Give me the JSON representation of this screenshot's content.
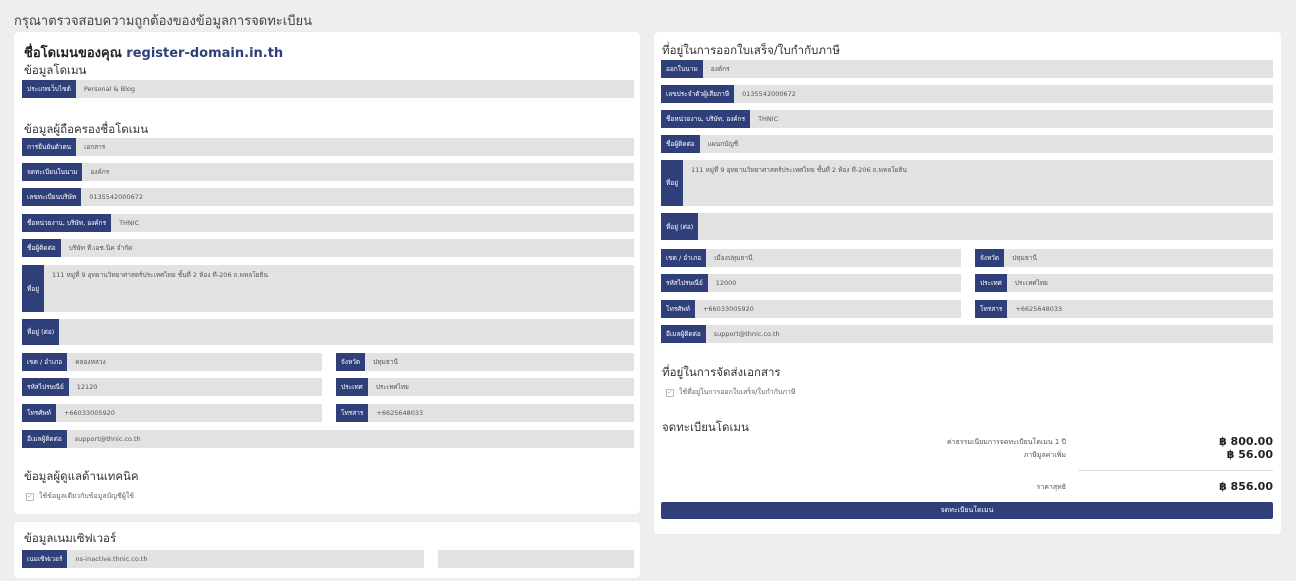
{
  "page_title": "กรุณาตรวจสอบความถูกต้องของข้อมูลการจดทะเบียน",
  "left": {
    "domain_heading_prefix": "ชื่อโดเมนของคุณ",
    "domain_name": "register-domain.in.th",
    "domain_section_title": "ข้อมูลโดเมน",
    "domain_type_label": "ประเภทเว็บไซต์",
    "domain_type_value": "Personal & Blog",
    "holder_section_title": "ข้อมูลผู้ถือครองชื่อโดเมน",
    "holder_fields": [
      {
        "label": "การยืนยันตัวตน",
        "value": "เอกสาร"
      },
      {
        "label": "จดทะเบียนในนาม",
        "value": "องค์กร"
      },
      {
        "label": "เลขทะเบียนบริษัท",
        "value": "0135542000672"
      },
      {
        "label": "ชื่อหน่วยงาน, บริษัท, องค์กร",
        "value": "THNIC"
      },
      {
        "label": "ชื่อผู้ติดต่อ",
        "value": "บริษัท ที.เอช.นิค จำกัด"
      }
    ],
    "address_label": "ที่อยู่",
    "address_value": "111 หมู่ที่ 9 อุทยานวิทยาศาสตร์ประเทศไทย ชั้นที่ 2 ห้อง ที-206 ถ.พหลโยธิน",
    "address2_label": "ที่อยู่ (ต่อ)",
    "address2_value": "",
    "district_label": "เขต / อำเภอ",
    "district_value": "คลองหลวง",
    "province_label": "จังหวัด",
    "province_value": "ปทุมธานี",
    "postcode_label": "รหัสไปรษณีย์",
    "postcode_value": "12120",
    "country_label": "ประเทศ",
    "country_value": "ประเทศไทย",
    "phone_label": "โทรศัพท์",
    "phone_value": "+66033005920",
    "fax_label": "โทรสาร",
    "fax_value": "+6625648033",
    "email_label": "อีเมลผู้ติดต่อ",
    "email_value": "support@thnic.co.th",
    "tech_section_title": "ข้อมูลผู้ดูแลด้านเทคนิค",
    "tech_checkbox_label": "ใช้ข้อมูลเดียวกับข้อมูลบัญชีผู้ใช้",
    "ns_section_title": "ข้อมูลเนมเซิฟเวอร์",
    "ns_label": "เนมเซิฟเวอร์",
    "ns_value": "ns-inactive.thnic.co.th"
  },
  "right": {
    "invoice_section_title": "ที่อยู่ในการออกใบเสร็จ/ใบกำกับภาษี",
    "invoice_fields": [
      {
        "label": "ออกในนาม",
        "value": "องค์กร"
      },
      {
        "label": "เลขประจำตัวผู้เสียภาษี",
        "value": "0135542000672"
      },
      {
        "label": "ชื่อหน่วยงาน, บริษัท, องค์กร",
        "value": "THNIC"
      },
      {
        "label": "ชื่อผู้ติดต่อ",
        "value": "แผนกบัญชี"
      }
    ],
    "address_label": "ที่อยู่",
    "address_value": "111 หมู่ที่ 9 อุทยานวิทยาศาสตร์ประเทศไทย ชั้นที่ 2 ห้อง ที-206 ถ.พหลโยธิน",
    "address2_label": "ที่อยู่ (ต่อ)",
    "address2_value": "",
    "district_label": "เขต / อำเภอ",
    "district_value": "เมืองปทุมธานี",
    "province_label": "จังหวัด",
    "province_value": "ปทุมธานี",
    "postcode_label": "รหัสไปรษณีย์",
    "postcode_value": "12000",
    "country_label": "ประเทศ",
    "country_value": "ประเทศไทย",
    "phone_label": "โทรศัพท์",
    "phone_value": "+66033005920",
    "fax_label": "โทรสาร",
    "fax_value": "+6625648033",
    "email_label": "อีเมลผู้ติดต่อ",
    "email_value": "support@thnic.co.th",
    "shipping_section_title": "ที่อยู่ในการจัดส่งเอกสาร",
    "shipping_checkbox_label": "ใช้ที่อยู่ในการออกใบเสร็จ/ใบกำกับภาษี",
    "register_section_title": "จดทะเบียนโดเมน",
    "fee_label": "ค่าธรรมเนียมการจดทะเบียนโดเมน 1 ปี",
    "fee_value": "฿ 800.00",
    "vat_label": "ภาษีมูลค่าเพิ่ม",
    "vat_value": "฿ 56.00",
    "net_label": "ราคาสุทธิ",
    "net_value": "฿ 856.00",
    "submit_label": "จดทะเบียนโดเมน"
  }
}
